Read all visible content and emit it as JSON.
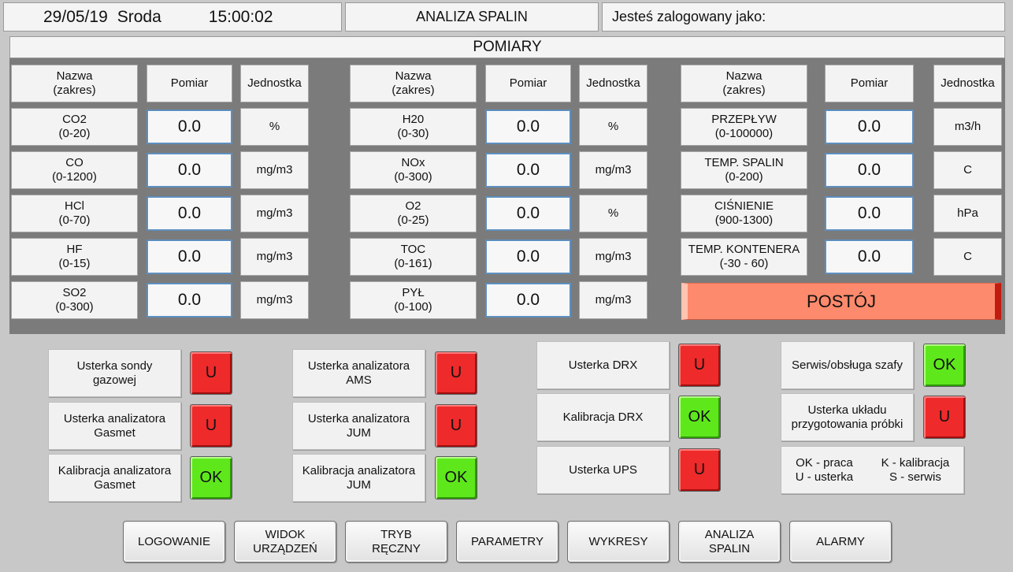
{
  "header": {
    "date": "29/05/19",
    "day": "Sroda",
    "time": "15:00:02",
    "screen_title": "ANALIZA SPALIN",
    "login_label": "Jesteś zalogowany jako:"
  },
  "measurements": {
    "title": "POMIARY",
    "col_name": "Nazwa\n(zakres)",
    "col_value": "Pomiar",
    "col_unit": "Jednostka",
    "columns": [
      [
        {
          "name": "CO2\n(0-20)",
          "value": "0.0",
          "unit": "%"
        },
        {
          "name": "CO\n(0-1200)",
          "value": "0.0",
          "unit": "mg/m3"
        },
        {
          "name": "HCl\n(0-70)",
          "value": "0.0",
          "unit": "mg/m3"
        },
        {
          "name": "HF\n(0-15)",
          "value": "0.0",
          "unit": "mg/m3"
        },
        {
          "name": "SO2\n(0-300)",
          "value": "0.0",
          "unit": "mg/m3"
        }
      ],
      [
        {
          "name": "H20\n(0-30)",
          "value": "0.0",
          "unit": "%"
        },
        {
          "name": "NOx\n(0-300)",
          "value": "0.0",
          "unit": "mg/m3"
        },
        {
          "name": "O2\n(0-25)",
          "value": "0.0",
          "unit": "%"
        },
        {
          "name": "TOC\n(0-161)",
          "value": "0.0",
          "unit": "mg/m3"
        },
        {
          "name": "PYŁ\n(0-100)",
          "value": "0.0",
          "unit": "mg/m3"
        }
      ],
      [
        {
          "name": "PRZEPŁYW\n(0-100000)",
          "value": "0.0",
          "unit": "m3/h"
        },
        {
          "name": "TEMP. SPALIN\n(0-200)",
          "value": "0.0",
          "unit": "C"
        },
        {
          "name": "CIŚNIENIE\n(900-1300)",
          "value": "0.0",
          "unit": "hPa"
        },
        {
          "name": "TEMP. KONTENERA\n(-30 - 60)",
          "value": "0.0",
          "unit": "C"
        }
      ]
    ],
    "status_text": "POSTÓJ"
  },
  "status_groups": [
    [
      {
        "label": "Usterka sondy\ngazowej",
        "state": "U"
      },
      {
        "label": "Usterka analizatora\nGasmet",
        "state": "U"
      },
      {
        "label": "Kalibracja analizatora\nGasmet",
        "state": "OK"
      }
    ],
    [
      {
        "label": "Usterka analizatora\nAMS",
        "state": "U"
      },
      {
        "label": "Usterka analizatora\nJUM",
        "state": "U"
      },
      {
        "label": "Kalibracja analizatora\nJUM",
        "state": "OK"
      }
    ],
    [
      {
        "label": "Usterka DRX",
        "state": "U"
      },
      {
        "label": "Kalibracja DRX",
        "state": "OK"
      },
      {
        "label": "Usterka UPS",
        "state": "U"
      }
    ],
    [
      {
        "label": "Serwis/obsługa szafy",
        "state": "OK"
      },
      {
        "label": "Usterka układu\nprzygotowania próbki",
        "state": "U"
      }
    ]
  ],
  "legend": {
    "left": "OK - praca\nU - usterka",
    "right": "K - kalibracja\nS - serwis"
  },
  "nav": [
    "LOGOWANIE",
    "WIDOK\nURZĄDZEŃ",
    "TRYB\nRĘCZNY",
    "PARAMETRY",
    "WYKRESY",
    "ANALIZA\nSPALIN",
    "ALARMY"
  ],
  "colors": {
    "indicator_red": "#ee2a2a",
    "indicator_green": "#5ee81c",
    "status_postoj": "#fd8a6c",
    "panel_bg": "#7b7b7b"
  }
}
